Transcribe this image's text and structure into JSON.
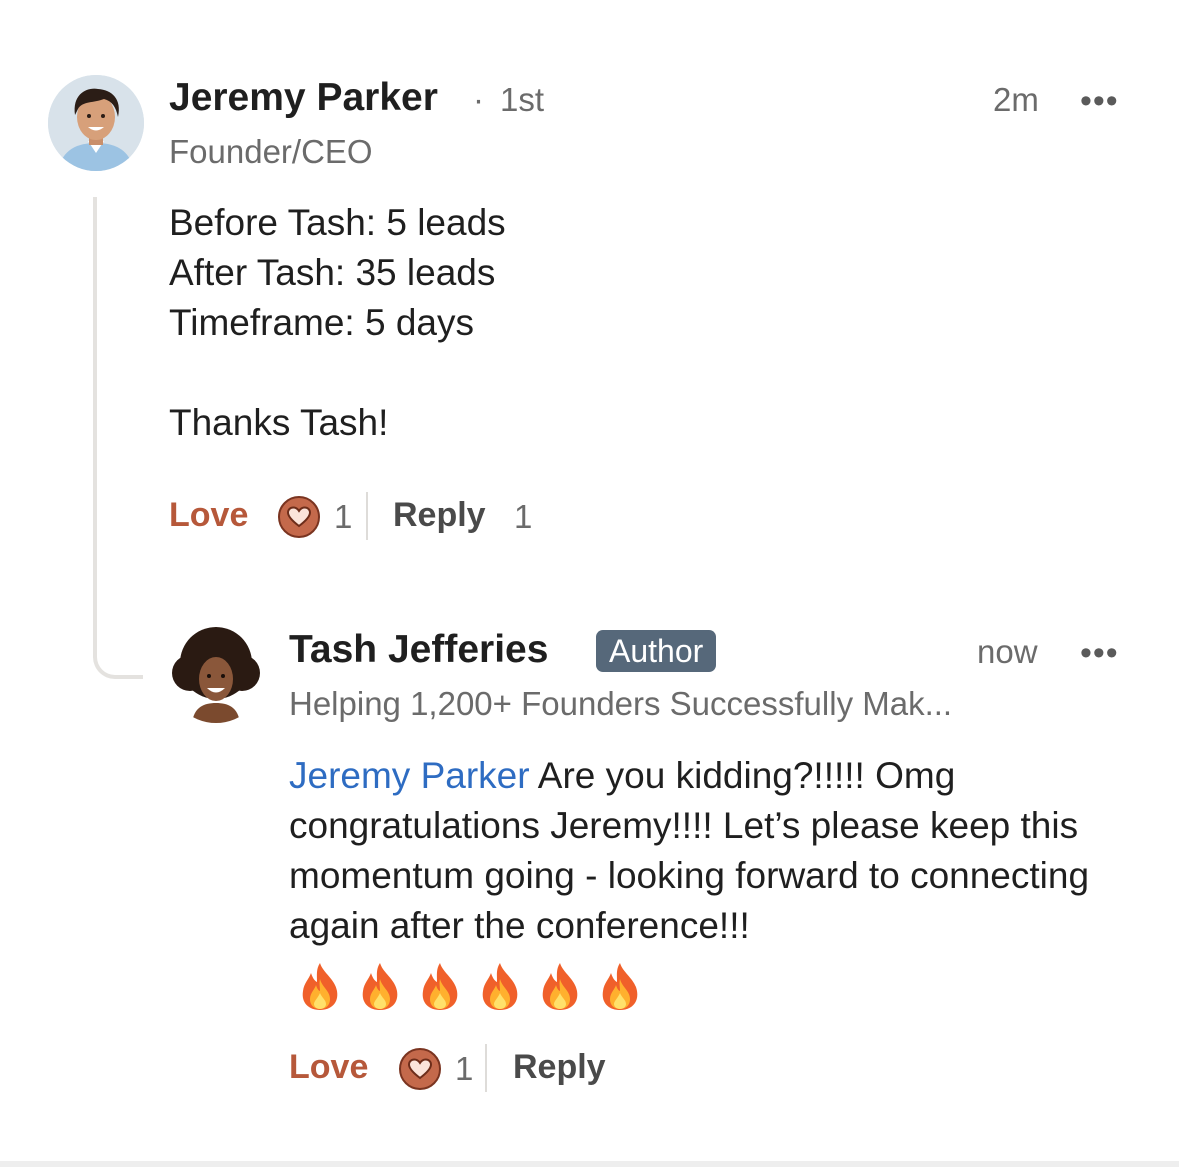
{
  "comment": {
    "author": "Jeremy Parker",
    "separator": "·",
    "degree": "1st",
    "headline": "Founder/CEO",
    "time": "2m",
    "more_label": "•••",
    "body_lines": [
      "Before Tash: 5 leads",
      "After Tash: 35 leads",
      "Timeframe: 5 days",
      "",
      "Thanks Tash!"
    ],
    "actions": {
      "love_label": "Love",
      "love_count": "1",
      "reply_label": "Reply",
      "reply_count": "1"
    }
  },
  "reply": {
    "author": "Tash Jefferies",
    "badge": "Author",
    "headline": "Helping 1,200+ Founders Successfully Mak...",
    "time": "now",
    "more_label": "•••",
    "mention": "Jeremy Parker",
    "body": " Are you kidding?!!!!! Omg congratulations Jeremy!!!! Let’s please keep this momentum going - looking forward to connecting again after the conference!!!",
    "emoji_icon": "fire-emoji",
    "emoji_count": 6,
    "actions": {
      "love_label": "Love",
      "love_count": "1",
      "reply_label": "Reply"
    }
  },
  "colors": {
    "love": "#b6583a",
    "mention": "#2e6cc2",
    "badge_bg": "#56687a",
    "heart_fill": "#c4694b"
  }
}
